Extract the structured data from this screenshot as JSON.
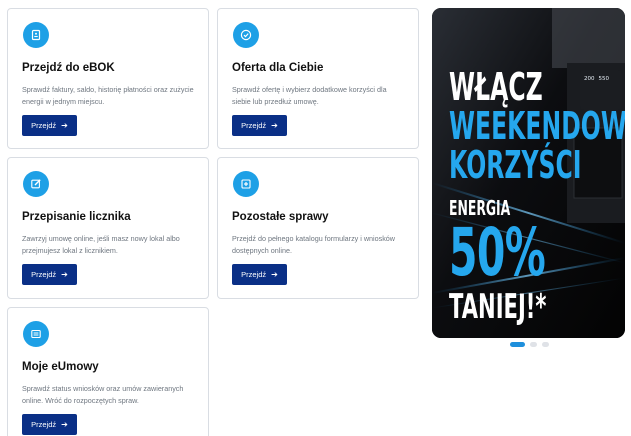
{
  "cards": [
    {
      "title": "Przejdź do eBOK",
      "description": "Sprawdź faktury, saldo, historię płatności oraz zużycie energii w jednym miejscu.",
      "button_label": "Przejdź",
      "icon": "document-icon"
    },
    {
      "title": "Oferta dla Ciebie",
      "description": "Sprawdź ofertę i wybierz dodatkowe korzyści dla siebie lub przedłuż umowę.",
      "button_label": "Przejdź",
      "icon": "check-circle-icon"
    },
    {
      "title": "Przepisanie licznika",
      "description": "Zawrzyj umowę online, jeśli masz nowy lokal albo przejmujesz lokal z licznikiem.",
      "button_label": "Przejdź",
      "icon": "edit-icon"
    },
    {
      "title": "Pozostałe sprawy",
      "description": "Przejdź do pełnego katalogu formularzy i wniosków dostępnych online.",
      "button_label": "Przejdź",
      "icon": "plus-square-icon"
    },
    {
      "title": "Moje eUmowy",
      "description": "Sprawdź status wniosków oraz umów zawieranych online. Wróć do rozpoczętych spraw.",
      "button_label": "Przejdź",
      "icon": "list-icon"
    }
  ],
  "banner": {
    "line1": "WŁĄCZ",
    "line2": "WEEKENDOWE",
    "line3": "KORZYŚCI",
    "line4": "ENERGIA",
    "line5": "50%",
    "line6": "TANIEJ!*",
    "oven_display_left": "200",
    "oven_display_right": "550"
  },
  "carousel": {
    "slides": 3,
    "active": 0
  },
  "colors": {
    "accent": "#1ea0e6",
    "button": "#0a2f86",
    "banner_text_blue": "#25a7ee",
    "card_border": "#d9dde3",
    "muted_text": "#6f7780"
  }
}
